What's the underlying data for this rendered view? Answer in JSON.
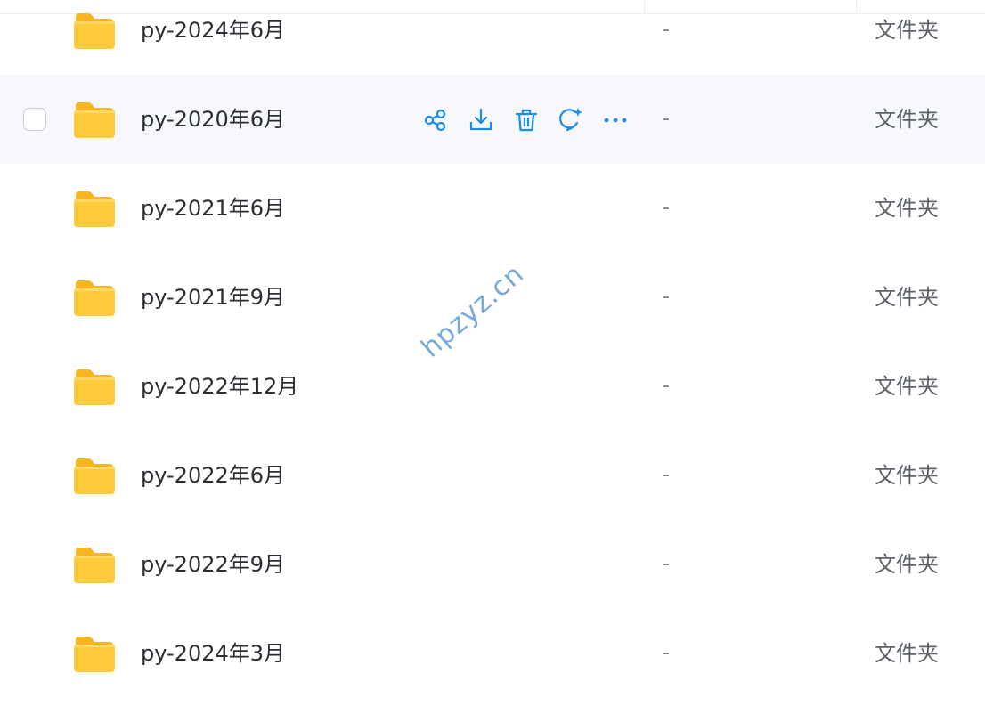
{
  "files": [
    {
      "name": "py-2024年6月",
      "size": "-",
      "type": "文件夹",
      "hovered": false
    },
    {
      "name": "py-2020年6月",
      "size": "-",
      "type": "文件夹",
      "hovered": true
    },
    {
      "name": "py-2021年6月",
      "size": "-",
      "type": "文件夹",
      "hovered": false
    },
    {
      "name": "py-2021年9月",
      "size": "-",
      "type": "文件夹",
      "hovered": false
    },
    {
      "name": "py-2022年12月",
      "size": "-",
      "type": "文件夹",
      "hovered": false
    },
    {
      "name": "py-2022年6月",
      "size": "-",
      "type": "文件夹",
      "hovered": false
    },
    {
      "name": "py-2022年9月",
      "size": "-",
      "type": "文件夹",
      "hovered": false
    },
    {
      "name": "py-2024年3月",
      "size": "-",
      "type": "文件夹",
      "hovered": false
    }
  ],
  "row_actions": [
    "share-icon",
    "download-icon",
    "delete-icon",
    "ai-chat-icon",
    "more-icon"
  ],
  "colors": {
    "accent": "#1a8cf0",
    "folder": "#ffc93c",
    "hover_row": "#f6f8fb",
    "watermark": "#6fa6da"
  },
  "watermark": {
    "text": "hpzyz.cn"
  }
}
